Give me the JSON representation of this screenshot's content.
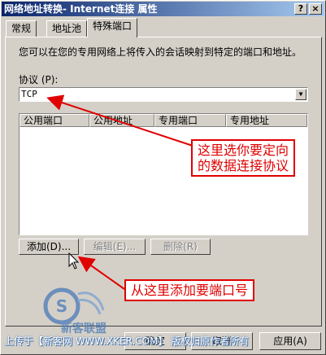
{
  "window": {
    "title": "网络地址转换- Internet连接 属性",
    "help_button": "?",
    "close_button": "×"
  },
  "tabs": [
    {
      "label": "常规"
    },
    {
      "label": "地址池"
    },
    {
      "label": "特殊端口"
    }
  ],
  "main": {
    "description": "您可以在您的专用网络上将传入的会话映射到特定的端口和地址。",
    "protocol_label": "协议 (P):",
    "protocol_value": "TCP",
    "columns": [
      "公用端口",
      "公用地址",
      "专用端口",
      "专用地址"
    ],
    "buttons": {
      "add": "添加(D)...",
      "edit": "编辑(E)...",
      "delete": "删除(R)"
    }
  },
  "annotations": {
    "protocol_note_line1": "这里选你要定向",
    "protocol_note_line2": "的数据连接协议",
    "add_note": "从这里添加要端口号"
  },
  "dialog_buttons": {
    "ok": "确定",
    "cancel": "取消",
    "apply": "应用(A)"
  },
  "watermark": {
    "text": "上传于【新客网 WWW.XKER.COM】 版权归原作者所有",
    "logo_text": "新客联盟"
  },
  "colors": {
    "face": "#d4d0c8",
    "title_start": "#0a246a",
    "title_end": "#a6caf0",
    "annotation": "#e00000"
  }
}
